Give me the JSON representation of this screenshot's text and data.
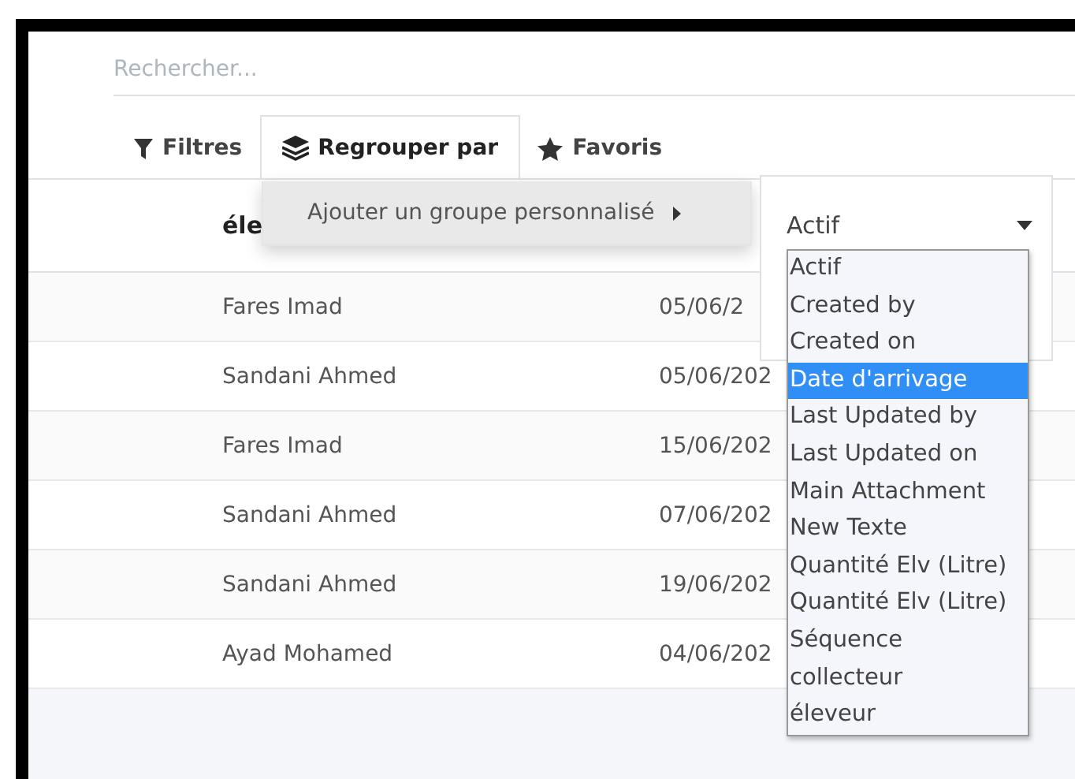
{
  "search": {
    "placeholder": "Rechercher..."
  },
  "toolbar": [
    {
      "label": "Filtres",
      "kind": "filter",
      "selected": false
    },
    {
      "label": "Regrouper par",
      "kind": "layers",
      "selected": true
    },
    {
      "label": "Favoris",
      "kind": "star",
      "selected": false
    }
  ],
  "table": {
    "columns": [
      "éle"
    ],
    "rows": [
      [
        "Fares Imad",
        "05/06/2"
      ],
      [
        "Sandani Ahmed",
        "05/06/202"
      ],
      [
        "Fares Imad",
        "15/06/202"
      ],
      [
        "Sandani Ahmed",
        "07/06/202"
      ],
      [
        "Sandani Ahmed",
        "19/06/202"
      ],
      [
        "Ayad Mohamed",
        "04/06/202"
      ]
    ]
  },
  "group_menu": {
    "item": "Ajouter un groupe personnalisé",
    "expanded": true
  },
  "group_field": {
    "value": "Actif"
  },
  "field_options": [
    {
      "label": "Actif",
      "selected": false
    },
    {
      "label": "Created by",
      "selected": false
    },
    {
      "label": "Created on",
      "selected": false
    },
    {
      "label": "Date d'arrivage",
      "selected": true
    },
    {
      "label": "Last Updated by",
      "selected": false
    },
    {
      "label": "Last Updated on",
      "selected": false
    },
    {
      "label": "Main Attachment",
      "selected": false
    },
    {
      "label": "New Texte",
      "selected": false
    },
    {
      "label": "Quantité Elv (Litre)",
      "selected": false
    },
    {
      "label": "Quantité Elv (Litre)",
      "selected": false
    },
    {
      "label": "Séquence",
      "selected": false
    },
    {
      "label": "collecteur",
      "selected": false
    },
    {
      "label": "éleveur",
      "selected": false
    }
  ]
}
